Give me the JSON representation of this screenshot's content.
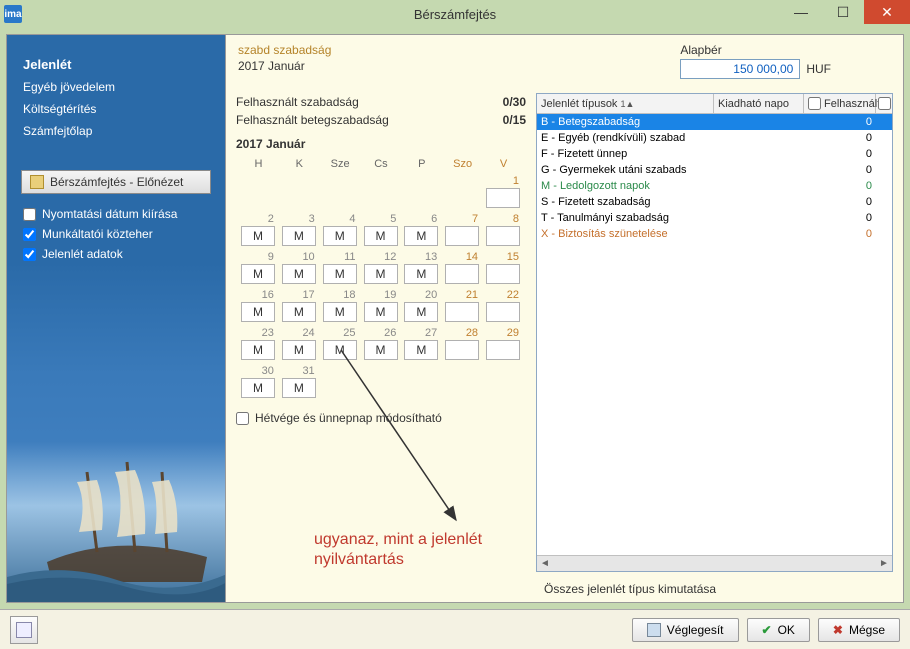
{
  "window": {
    "title": "Bérszámfejtés",
    "appicon_text": "ima"
  },
  "sidebar": {
    "items": [
      {
        "label": "Jelenlét",
        "active": true
      },
      {
        "label": "Egyéb jövedelem",
        "active": false
      },
      {
        "label": "Költségtérítés",
        "active": false
      },
      {
        "label": "Számfejtőlap",
        "active": false
      }
    ],
    "preview_button": "Bérszámfejtés - Előnézet",
    "checkboxes": [
      {
        "label": "Nyomtatási dátum kiírása",
        "checked": false
      },
      {
        "label": "Munkáltatói közteher",
        "checked": true
      },
      {
        "label": "Jelenlét adatok",
        "checked": true
      }
    ]
  },
  "header": {
    "szabad": "szabd szabadság",
    "period": "2017 Január",
    "alapber_label": "Alapbér",
    "alapber_value": "150 000,00",
    "alapber_unit": "HUF"
  },
  "used": {
    "vac_label": "Felhasznált szabadság",
    "vac_value": "0/30",
    "sick_label": "Felhasznált betegszabadság",
    "sick_value": "0/15"
  },
  "calendar": {
    "month_label": "2017 Január",
    "day_headers": [
      "H",
      "K",
      "Sze",
      "Cs",
      "P",
      "Szo",
      "V"
    ],
    "weekend_checkbox": "Hétvége és ünnepnap módosítható",
    "weeks": [
      [
        null,
        null,
        null,
        null,
        null,
        null,
        {
          "n": 1,
          "v": "",
          "w": true
        }
      ],
      [
        {
          "n": 2,
          "v": "M"
        },
        {
          "n": 3,
          "v": "M"
        },
        {
          "n": 4,
          "v": "M"
        },
        {
          "n": 5,
          "v": "M"
        },
        {
          "n": 6,
          "v": "M"
        },
        {
          "n": 7,
          "v": "",
          "w": true
        },
        {
          "n": 8,
          "v": "",
          "w": true
        }
      ],
      [
        {
          "n": 9,
          "v": "M"
        },
        {
          "n": 10,
          "v": "M"
        },
        {
          "n": 11,
          "v": "M"
        },
        {
          "n": 12,
          "v": "M"
        },
        {
          "n": 13,
          "v": "M"
        },
        {
          "n": 14,
          "v": "",
          "w": true
        },
        {
          "n": 15,
          "v": "",
          "w": true
        }
      ],
      [
        {
          "n": 16,
          "v": "M"
        },
        {
          "n": 17,
          "v": "M"
        },
        {
          "n": 18,
          "v": "M"
        },
        {
          "n": 19,
          "v": "M"
        },
        {
          "n": 20,
          "v": "M"
        },
        {
          "n": 21,
          "v": "",
          "w": true
        },
        {
          "n": 22,
          "v": "",
          "w": true
        }
      ],
      [
        {
          "n": 23,
          "v": "M"
        },
        {
          "n": 24,
          "v": "M"
        },
        {
          "n": 25,
          "v": "M"
        },
        {
          "n": 26,
          "v": "M"
        },
        {
          "n": 27,
          "v": "M"
        },
        {
          "n": 28,
          "v": "",
          "w": true
        },
        {
          "n": 29,
          "v": "",
          "w": true
        }
      ],
      [
        {
          "n": 30,
          "v": "M"
        },
        {
          "n": 31,
          "v": "M"
        },
        null,
        null,
        null,
        null,
        null
      ]
    ]
  },
  "types": {
    "columns": [
      "Jelenlét típusok",
      "Kiadható napo",
      "Felhasznált"
    ],
    "rows": [
      {
        "label": "B - Betegszabadság",
        "used": "0",
        "cls": "selected"
      },
      {
        "label": "E - Egyéb (rendkívüli) szabad",
        "used": "0",
        "cls": ""
      },
      {
        "label": "F - Fizetett ünnep",
        "used": "0",
        "cls": ""
      },
      {
        "label": "G - Gyermekek utáni szabads",
        "used": "0",
        "cls": ""
      },
      {
        "label": "M - Ledolgozott napok",
        "used": "0",
        "cls": "green"
      },
      {
        "label": "S - Fizetett szabadság",
        "used": "0",
        "cls": ""
      },
      {
        "label": "T - Tanulmányi szabadság",
        "used": "0",
        "cls": ""
      },
      {
        "label": "X - Biztosítás szünetelése",
        "used": "0",
        "cls": "orange"
      }
    ],
    "footer": "Összes jelenlét típus kimutatása"
  },
  "annotation": {
    "line1": "ugyanaz, mint a jelenlét",
    "line2": "nyilvántartás"
  },
  "buttons": {
    "veglegesit": "Véglegesít",
    "ok": "OK",
    "megse": "Mégse"
  }
}
